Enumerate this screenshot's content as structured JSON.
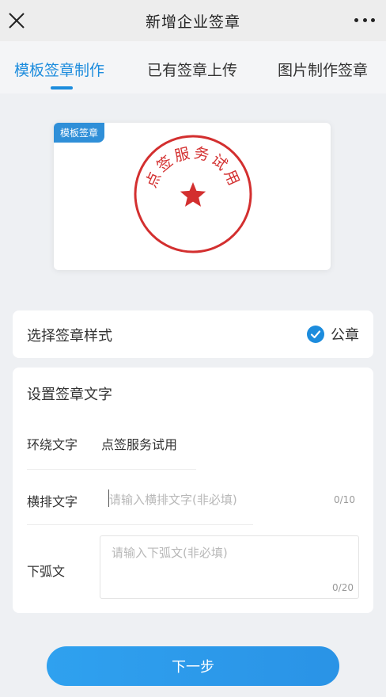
{
  "header": {
    "title": "新增企业签章",
    "close_icon": "close-icon",
    "more_icon": "more-dots-icon"
  },
  "tabs": [
    {
      "label": "模板签章制作",
      "active": true
    },
    {
      "label": "已有签章上传",
      "active": false
    },
    {
      "label": "图片制作签章",
      "active": false
    }
  ],
  "preview": {
    "badge": "模板签章",
    "seal_text": "点签服务试用",
    "seal_color": "#d32f2f"
  },
  "style_section": {
    "label": "选择签章样式",
    "selected_option": "公章"
  },
  "text_section": {
    "title": "设置签章文字",
    "surround": {
      "label": "环绕文字",
      "value": "点签服务试用"
    },
    "horizontal": {
      "label": "横排文字",
      "placeholder": "请输入横排文字(非必填)",
      "counter": "0/10"
    },
    "lower_arc": {
      "label": "下弧文",
      "placeholder": "请输入下弧文(非必填)",
      "counter": "0/20"
    }
  },
  "footer": {
    "next_label": "下一步"
  },
  "colors": {
    "accent": "#1c8cdd",
    "seal": "#d32f2f"
  }
}
